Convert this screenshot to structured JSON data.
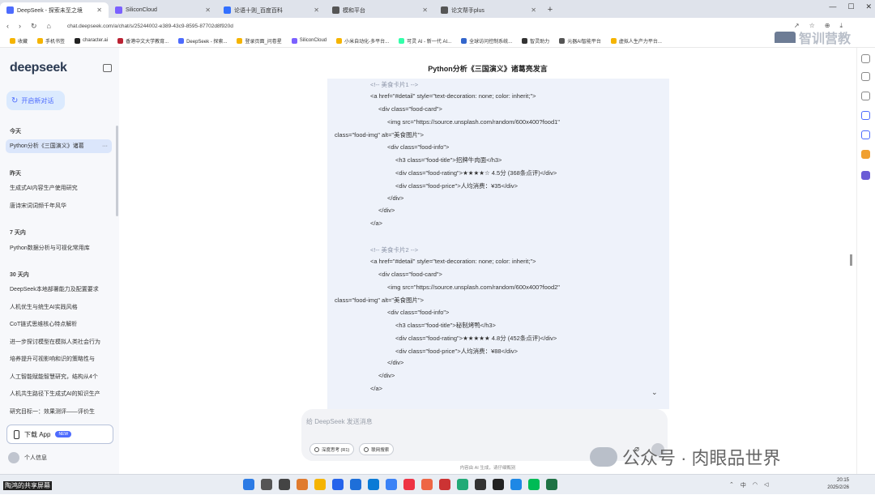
{
  "browser": {
    "tabs": [
      {
        "label": "DeepSeek - 探索未至之境",
        "active": true,
        "color": "#4d6bfe"
      },
      {
        "label": "SiliconCloud",
        "active": false,
        "color": "#7b61ff"
      },
      {
        "label": "论语十则_百度百科",
        "active": false,
        "color": "#3370ff"
      },
      {
        "label": "模和平台",
        "active": false,
        "color": "#555555"
      },
      {
        "label": "论文帮手plus",
        "active": false,
        "color": "#555555"
      }
    ],
    "new_tab": "+",
    "url": "chat.deepseek.com/a/chat/s/25244002-e389-43c9-8595-87702d8f920d",
    "bookmarks": [
      "收藏",
      "手机书签",
      "character.ai",
      "香港中文大学教育...",
      "DeepSeek - 探索...",
      "登录页面_问卷星",
      "SiliconCloud",
      "小米自动化-多平台...",
      "可灵 AI - 新一代 AI...",
      "全球访问控制系统...",
      "智灵助力",
      "元器AI智能平台",
      "虚拟人生产力平台..."
    ],
    "watermark_text": "智训营教"
  },
  "sidebar": {
    "brand": "deepseek",
    "new_chat": "开启新对话",
    "groups": [
      {
        "label": "今天",
        "items": [
          "Python分析《三国演义》诸葛"
        ]
      },
      {
        "label": "昨天",
        "items": [
          "生成式AI内容生产使用研究",
          "唐诗宋词词频千年风华"
        ]
      },
      {
        "label": "7 天内",
        "items": [
          "Python数据分析与可视化常用库"
        ]
      },
      {
        "label": "30 天内",
        "items": [
          "DeepSeek本地部署能力及配置要求",
          "人机优生与统生AI实践风格",
          "CoT链式思维核心特点解析",
          "进一步探讨模型在模拟人类社会行为",
          "培养提升可视影响和识的策略性与",
          "人工智能赋能智慧研究，结构从4个",
          "人机共生路径下生成式AI的知识生产",
          "研究目标一：效果测评——评价生"
        ]
      }
    ],
    "more": "···",
    "download": "下载 App",
    "new_badge": "NEW",
    "profile": "个人信息"
  },
  "chat": {
    "title": "Python分析《三国演义》诸葛亮发言",
    "code_lines": [
      {
        "t": "<!-- 美食卡片1 -->",
        "c": true
      },
      {
        "t": "<a href=\"#detail\" style=\"text-decoration: none; color: inherit;\">",
        "c": false
      },
      {
        "t": "<div class=\"food-card\">",
        "c": false
      },
      {
        "t": "<img src=\"https://source.unsplash.com/random/600x400?food1\"",
        "c": false
      },
      {
        "t": "class=\"food-img\" alt=\"美食图片\">",
        "c": false
      },
      {
        "t": "<div class=\"food-info\">",
        "c": false
      },
      {
        "t": "<h3 class=\"food-title\">招牌牛肉面</h3>",
        "c": false
      },
      {
        "t": "<div class=\"food-rating\">★★★★☆ 4.5分 (368条点评)</div>",
        "c": false
      },
      {
        "t": "<div class=\"food-price\">人均消费：¥35</div>",
        "c": false
      },
      {
        "t": "</div>",
        "c": false
      },
      {
        "t": "</div>",
        "c": false
      },
      {
        "t": "</a>",
        "c": false
      },
      {
        "t": "",
        "c": false
      },
      {
        "t": "<!-- 美食卡片2 -->",
        "c": true
      },
      {
        "t": "<a href=\"#detail\" style=\"text-decoration: none; color: inherit;\">",
        "c": false
      },
      {
        "t": "<div class=\"food-card\">",
        "c": false
      },
      {
        "t": "<img src=\"https://source.unsplash.com/random/600x400?food2\"",
        "c": false
      },
      {
        "t": "class=\"food-img\" alt=\"美食图片\">",
        "c": false
      },
      {
        "t": "<div class=\"food-info\">",
        "c": false
      },
      {
        "t": "<h3 class=\"food-title\">秘制烤鸭</h3>",
        "c": false
      },
      {
        "t": "<div class=\"food-rating\">★★★★★ 4.8分 (452条点评)</div>",
        "c": false
      },
      {
        "t": "<div class=\"food-price\">人均消费：¥88</div>",
        "c": false
      },
      {
        "t": "</div>",
        "c": false
      },
      {
        "t": "</div>",
        "c": false
      },
      {
        "t": "</a>",
        "c": false
      }
    ],
    "placeholder": "给 DeepSeek 发送消息",
    "deepthink": "深度思考 (R1)",
    "search": "联网搜索",
    "disclaimer": "内容由 AI 生成，请仔细甄别"
  },
  "overlay": {
    "watermark": "公众号 · 肉眼品世界"
  },
  "taskbar": {
    "share_label": "陶鸿的共享屏幕",
    "time": "20:15",
    "date": "2025/2/26",
    "tray_lang": "中"
  }
}
